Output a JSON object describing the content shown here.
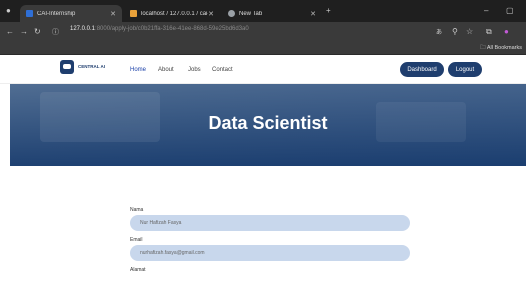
{
  "browser": {
    "tabs": [
      {
        "title": "CAI-Internship",
        "active": true
      },
      {
        "title": "localhost / 127.0.0.1 / cai-interr",
        "active": false
      },
      {
        "title": "New Tab",
        "active": false
      }
    ],
    "new_tab": "+",
    "url_host": "127.0.0.1",
    "url_path": ":8000/apply-job/c0b21ffa-316e-41ee-868d-59e25bd6d3a0",
    "bookmarks_label": "All Bookmarks"
  },
  "site": {
    "logo_line1": "CENTRAL AI",
    "nav": [
      {
        "label": "Home",
        "active": true
      },
      {
        "label": "About",
        "active": false
      },
      {
        "label": "Jobs",
        "active": false
      },
      {
        "label": "Contact",
        "active": false
      }
    ],
    "dashboard_label": "Dashboard",
    "logout_label": "Logout"
  },
  "hero": {
    "title": "Data Scientist"
  },
  "form": {
    "fields": [
      {
        "label": "Nama",
        "value": "Nur Hafizah Fasya"
      },
      {
        "label": "Email",
        "value": "nurhafizah.fasya@gmail.com"
      }
    ],
    "next_label": "Alamat"
  },
  "colors": {
    "primary": "#1f3e6e",
    "field_bg": "#c8d7ec",
    "tab_bg": "#1f1f1f"
  }
}
